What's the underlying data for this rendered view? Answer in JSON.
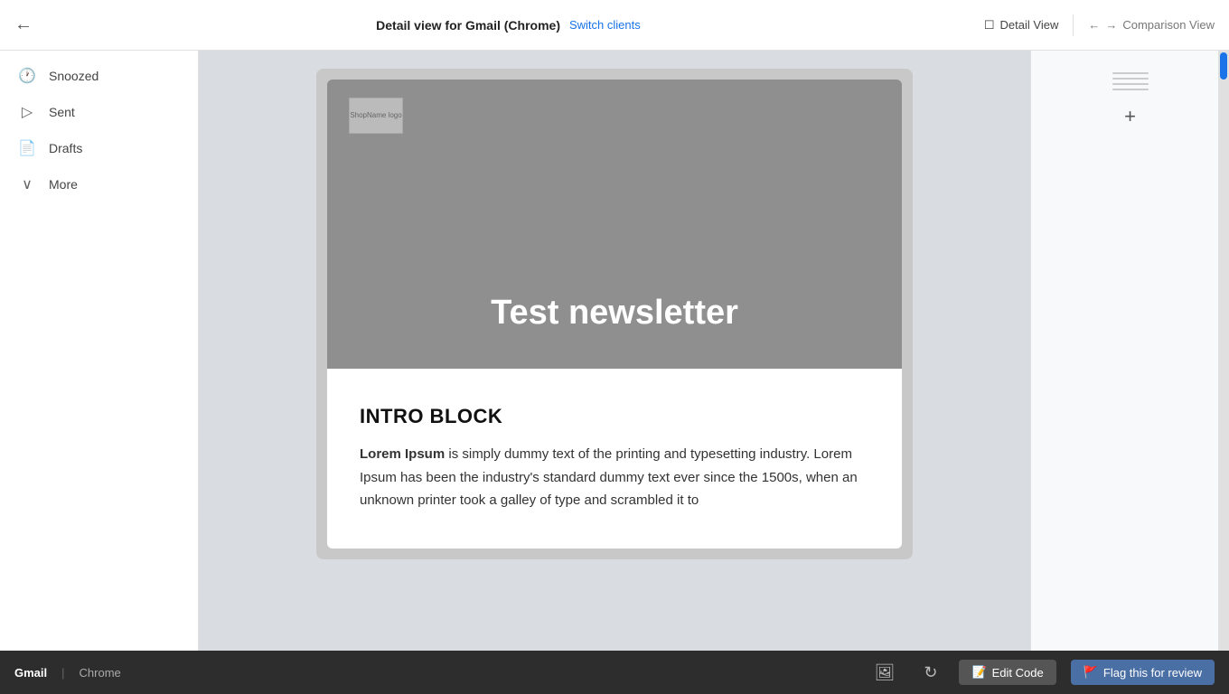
{
  "header": {
    "back_icon": "←",
    "title": "Detail view for Gmail (Chrome)",
    "switch_clients_label": "Switch clients",
    "detail_view_label": "Detail View",
    "comparison_nav_prev": "←",
    "comparison_nav_next": "→",
    "comparison_view_label": "Comparison View",
    "monitor_icon": "⬜"
  },
  "sidebar": {
    "items": [
      {
        "id": "snoozed",
        "icon": "🕐",
        "label": "Snoozed"
      },
      {
        "id": "sent",
        "icon": "▷",
        "label": "Sent"
      },
      {
        "id": "drafts",
        "icon": "📄",
        "label": "Drafts"
      },
      {
        "id": "more",
        "icon": "∨",
        "label": "More"
      }
    ]
  },
  "email": {
    "shop_logo_alt": "ShopName logo",
    "hero_title": "Test newsletter",
    "intro_block_title": "INTRO BLOCK",
    "intro_text_bold": "Lorem Ipsum",
    "intro_text_rest": " is simply dummy text of the printing and typesetting industry. Lorem Ipsum has been the industry's standard dummy text ever since the 1500s, when an unknown printer took a galley of type and scrambled it to"
  },
  "right_panel": {
    "add_icon": "+"
  },
  "bottom_bar": {
    "client_label": "Gmail",
    "divider": "|",
    "client_type": "Chrome",
    "image_icon": "🖼",
    "refresh_icon": "↻",
    "edit_code_label": "Edit Code",
    "flag_review_label": "Flag this for review"
  }
}
